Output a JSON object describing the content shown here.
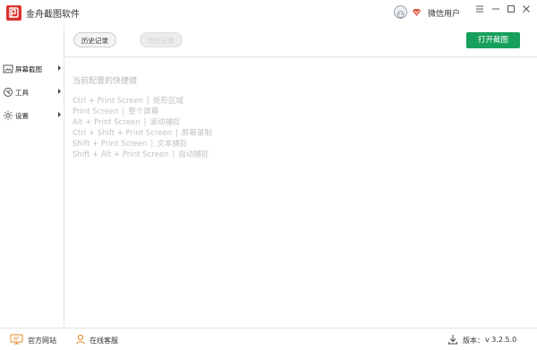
{
  "window": {
    "title": "金舟截图软件",
    "username": "微信用户"
  },
  "toolbar": {
    "history_label": "历史记录",
    "disabled_label": "历史记录",
    "open_label": "打开截图"
  },
  "sidebar": {
    "items": [
      {
        "label": "屏幕截图",
        "icon": "screenshot-icon"
      },
      {
        "label": "工具",
        "icon": "tools-icon"
      },
      {
        "label": "设置",
        "icon": "gear-icon"
      }
    ]
  },
  "main": {
    "hint_title": "当前配置的快捷键",
    "shortcuts": [
      {
        "keys": "Ctrl + Print Screen",
        "action": "矩形区域"
      },
      {
        "keys": "Print Screen",
        "action": "整个屏幕"
      },
      {
        "keys": "Alt + Print Screen",
        "action": "滚动捕捉"
      },
      {
        "keys": "Ctrl + Shift + Print Screen",
        "action": "屏幕录制"
      },
      {
        "keys": "Shift + Print Screen",
        "action": "文本捕捉"
      },
      {
        "keys": "Shift + Alt + Print Screen",
        "action": "自动捕捉"
      }
    ]
  },
  "footer": {
    "website_label": "官方网站",
    "service_label": "在线客服",
    "version_label": "版本：",
    "version_value": "v 3.2.5.0"
  },
  "colors": {
    "accent_green": "#17a05c",
    "logo_red": "#d9322c"
  }
}
